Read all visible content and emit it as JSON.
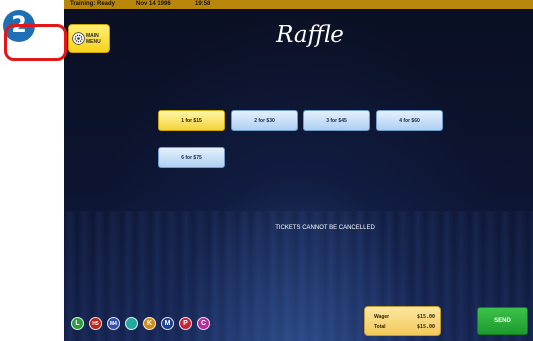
{
  "step_badge": "2",
  "status_bar": {
    "training": "Training: Ready",
    "date": "Nov 14 1996",
    "time": "19:58"
  },
  "menu_button": {
    "label": "MAIN MENU",
    "icon": "gear-menu-icon"
  },
  "title": "Raffle",
  "ticket_options": [
    {
      "label": "1 for $15",
      "selected": true
    },
    {
      "label": "2 for $30",
      "selected": false
    },
    {
      "label": "3 for $45",
      "selected": false
    },
    {
      "label": "4 for $60",
      "selected": false
    },
    {
      "label": "6 for $75",
      "selected": false
    }
  ],
  "notice": "TICKETS CANNOT BE CANCELLED",
  "game_icons": [
    {
      "letter": "L",
      "color": "#2e9e3c"
    },
    {
      "letter": "H5",
      "color": "#b8261e"
    },
    {
      "letter": "M4",
      "color": "#3450a8"
    },
    {
      "letter": "",
      "color": "#23a7a0"
    },
    {
      "letter": "K",
      "color": "#d48c14"
    },
    {
      "letter": "M",
      "color": "#1d3f8f"
    },
    {
      "letter": "P",
      "color": "#c8243a"
    },
    {
      "letter": "C",
      "color": "#b72c9b"
    }
  ],
  "wager": {
    "wager_label": "Wager",
    "wager_value": "$15.00",
    "total_label": "Total",
    "total_value": "$15.00"
  },
  "send_label": "SEND",
  "colors": {
    "highlight": "#e01818",
    "selected_button": "#f3d33a",
    "status_bar": "#b8860b",
    "send": "#1e9a2f"
  }
}
